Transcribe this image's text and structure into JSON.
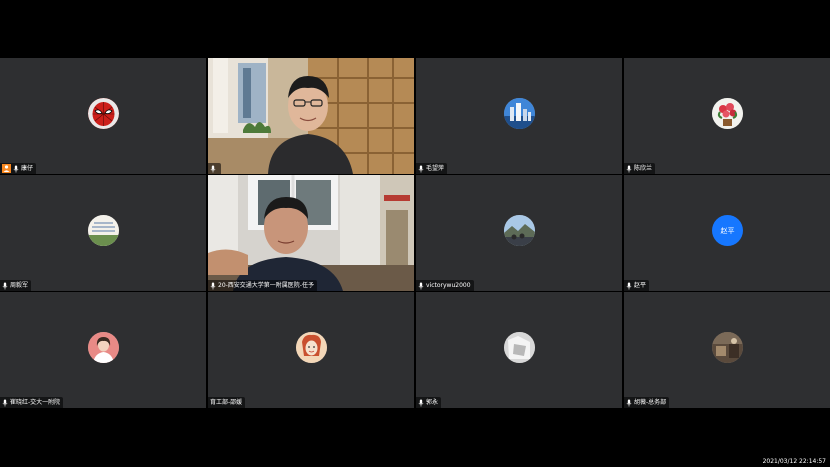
{
  "tiles": [
    {
      "name": "康仔",
      "avatar": "spiderman-avatar",
      "host": true
    },
    {
      "name": "",
      "video": "man-with-glasses-bookshelf"
    },
    {
      "name": "毛望萍",
      "avatar": "city-avatar"
    },
    {
      "name": "陈欣兰",
      "avatar": "flower-avatar"
    },
    {
      "name": "周毅军",
      "avatar": "text-avatar"
    },
    {
      "name": "20-西安交通大学第一附属医院-任予",
      "video": "man-in-office"
    },
    {
      "name": "victorywu2000",
      "avatar": "landscape-avatar"
    },
    {
      "name": "赵平",
      "avatar": "initials-avatar",
      "initials": "赵平"
    },
    {
      "name": "崔晓红-交大一附院",
      "avatar": "woman-avatar"
    },
    {
      "name": "育工部-邵媛",
      "avatar": "cartoon-avatar"
    },
    {
      "name": "郭永",
      "avatar": "gray-photo-avatar"
    },
    {
      "name": "胡薇-总务部",
      "avatar": "room-avatar"
    }
  ],
  "status": {
    "timestamp": "2021/03/12 22:14:57"
  },
  "colors": {
    "background": "#000000",
    "tile": "#2e2f31",
    "host_badge": "#f7871f",
    "initials_avatar": "#1677ff"
  }
}
